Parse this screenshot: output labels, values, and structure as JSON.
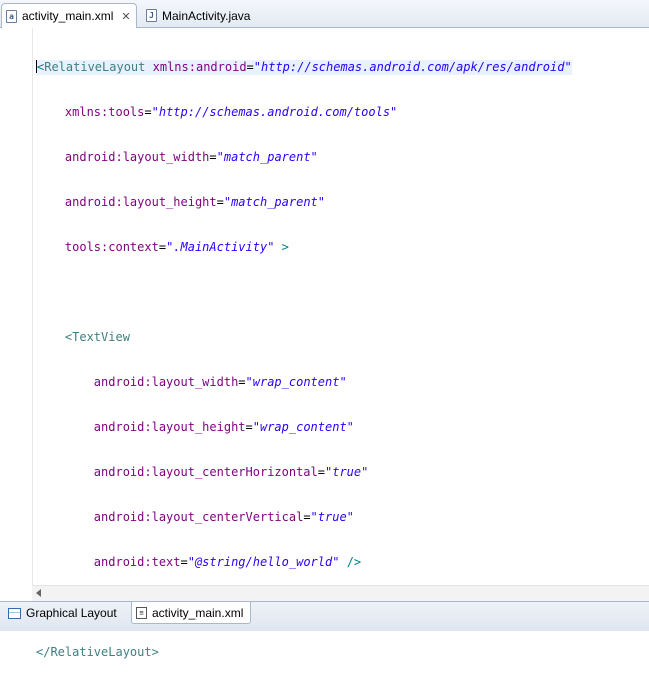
{
  "tabs": [
    {
      "label": "activity_main.xml",
      "icon": "android-xml-file-icon",
      "active": true,
      "closable": true
    },
    {
      "label": "MainActivity.java",
      "icon": "java-file-icon",
      "active": false
    }
  ],
  "bottom_tabs": [
    {
      "label": "Graphical Layout",
      "icon": "graphical-layout-icon"
    },
    {
      "label": "activity_main.xml",
      "icon": "xml-source-icon"
    }
  ],
  "code": {
    "l1": {
      "open": "<",
      "tag": "RelativeLayout",
      "attr": "xmlns:android",
      "eq": "=",
      "val": "\"http://schemas.android.com/apk/res/android\""
    },
    "l2": {
      "attr": "xmlns:tools",
      "eq": "=",
      "val": "\"http://schemas.android.com/tools\""
    },
    "l3": {
      "attr": "android:layout_width",
      "eq": "=",
      "val": "\"match_parent\""
    },
    "l4": {
      "attr": "android:layout_height",
      "eq": "=",
      "val": "\"match_parent\""
    },
    "l5": {
      "attr": "tools:context",
      "eq": "=",
      "val": "\".MainActivity\"",
      "close": ">"
    },
    "l7": {
      "tag": "<TextView"
    },
    "l8": {
      "attr": "android:layout_width",
      "eq": "=",
      "val": "\"wrap_content\""
    },
    "l9": {
      "attr": "android:layout_height",
      "eq": "=",
      "val": "\"wrap_content\""
    },
    "l10": {
      "attr": "android:layout_centerHorizontal",
      "eq": "=",
      "val": "\"true\""
    },
    "l11": {
      "attr": "android:layout_centerVertical",
      "eq": "=",
      "val": "\"true\""
    },
    "l12": {
      "attr": "android:text",
      "eq": "=",
      "val": "\"@string/hello_world\"",
      "close": "/>"
    },
    "l14": {
      "tag": "</RelativeLayout>"
    }
  }
}
